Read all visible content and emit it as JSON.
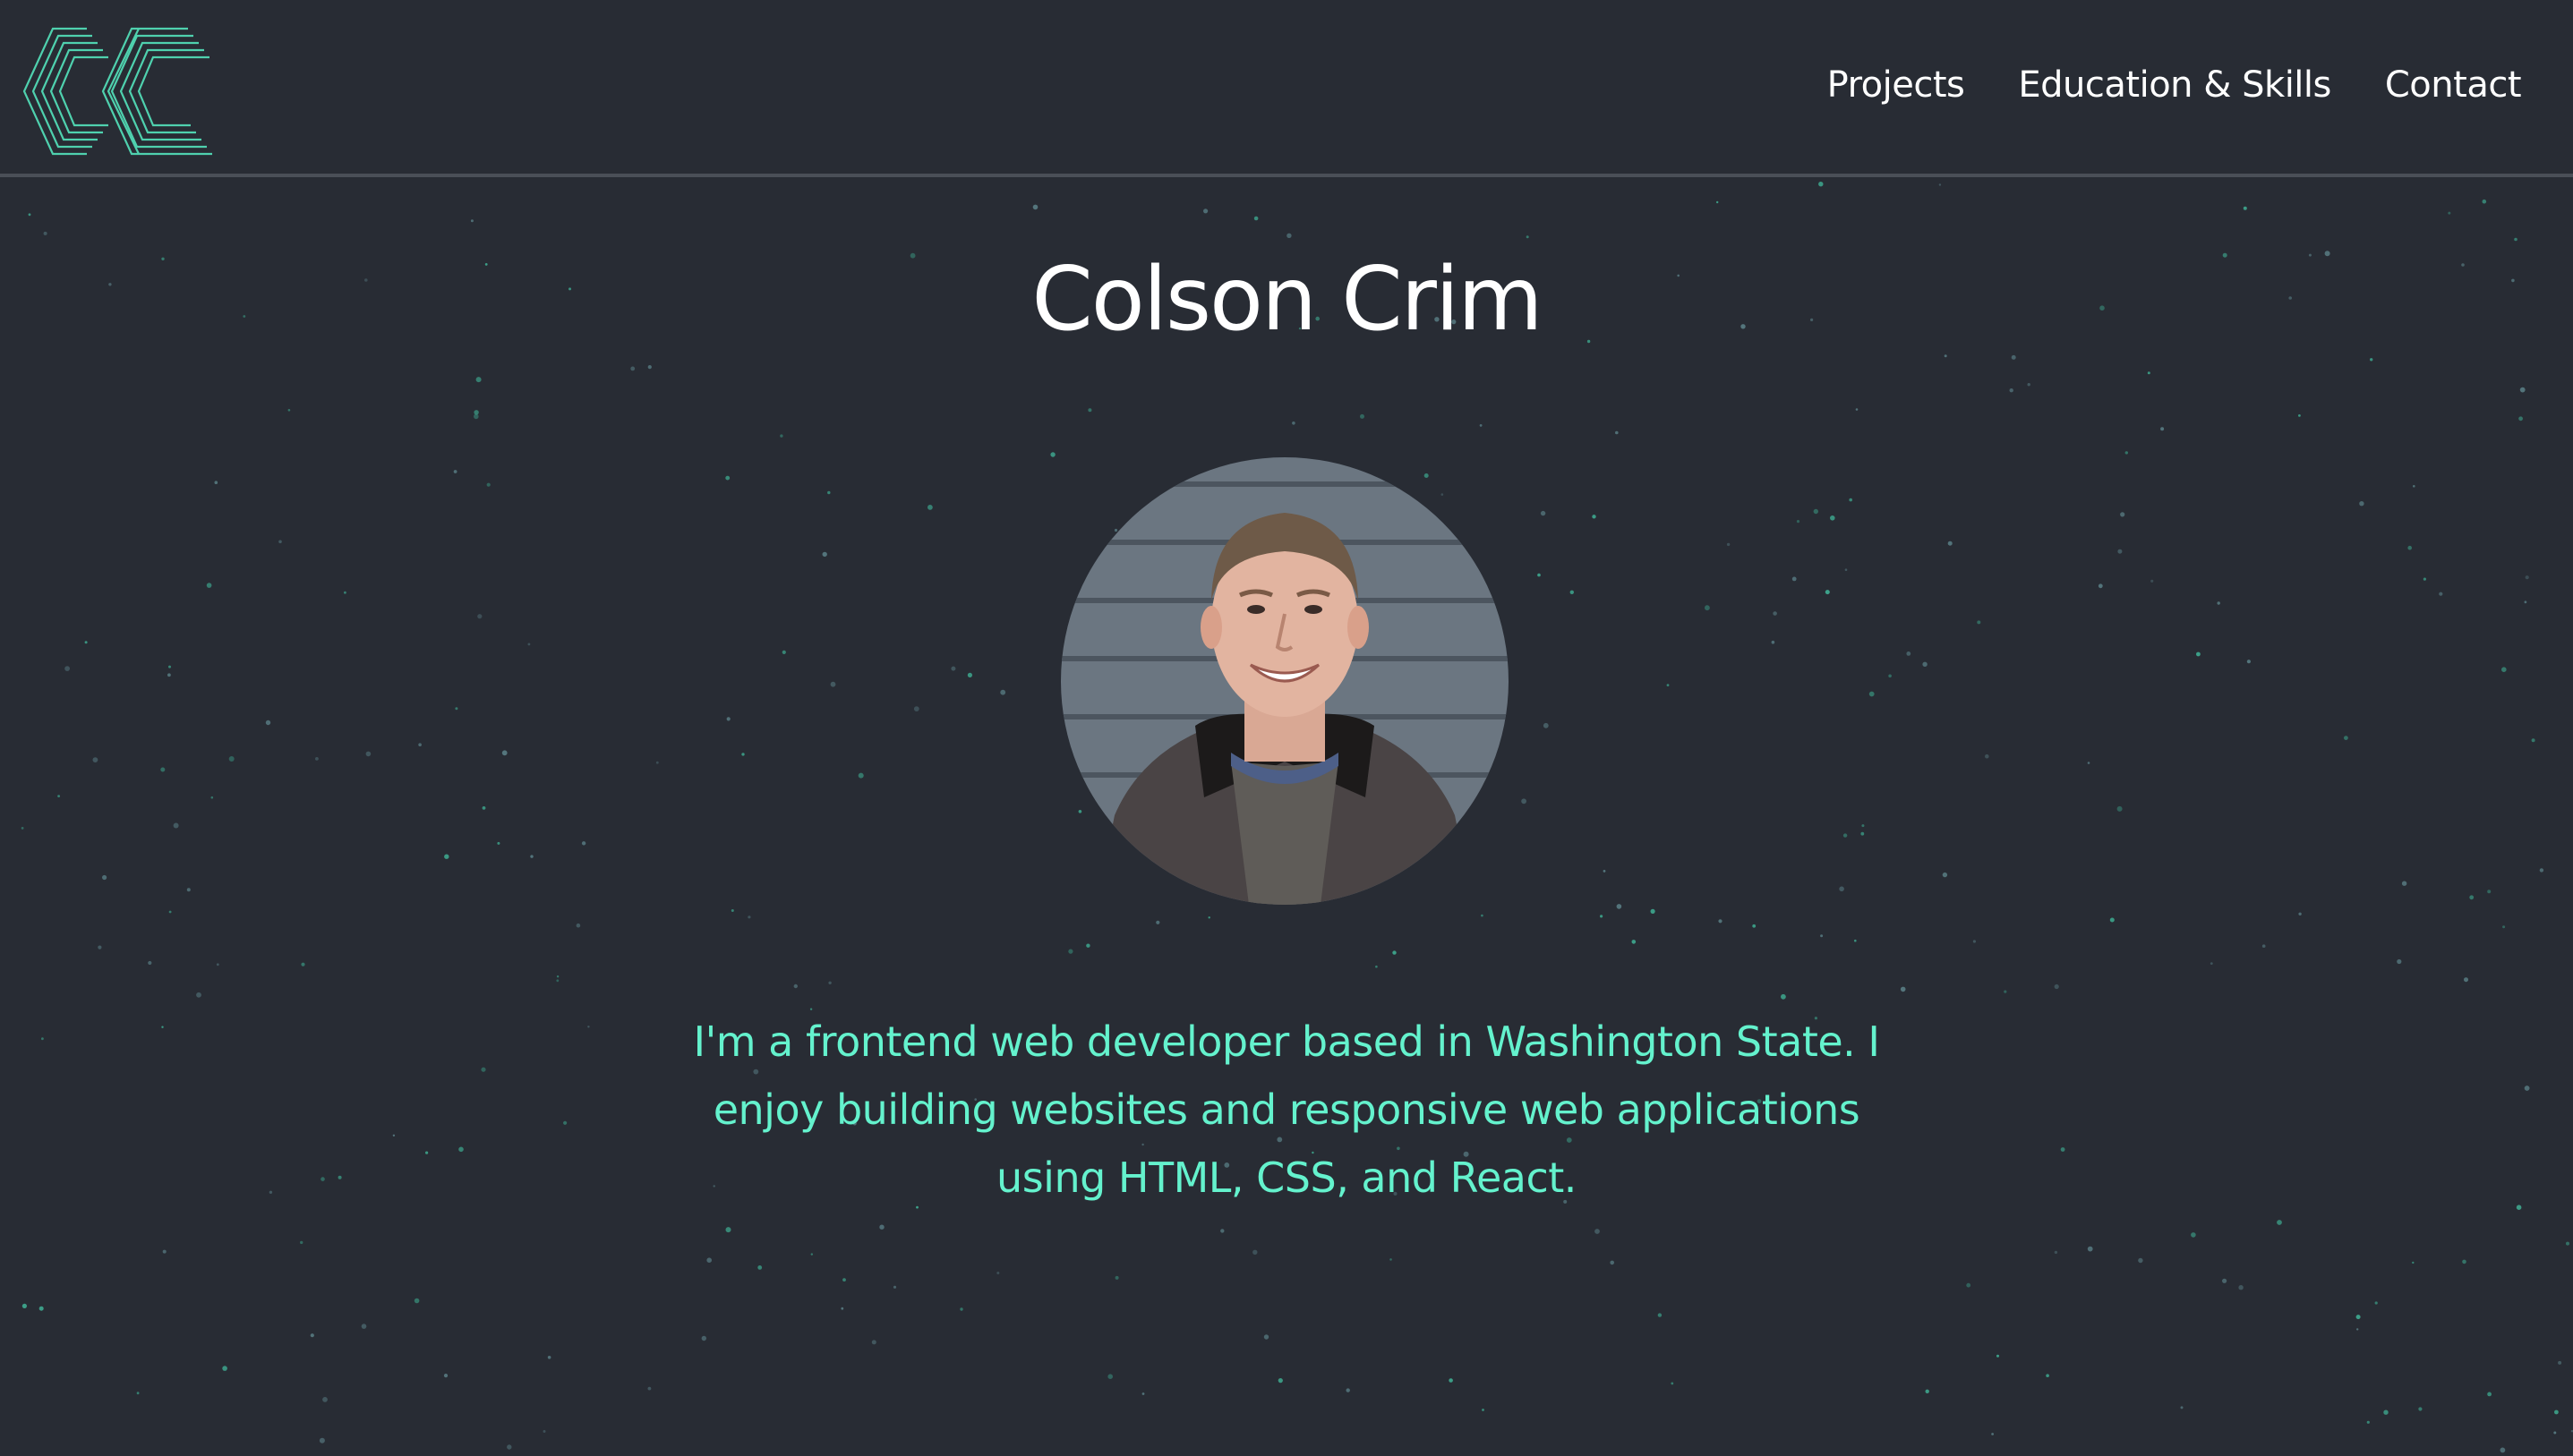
{
  "logo": {
    "label": "CC",
    "icon": "cc-monogram-logo-icon"
  },
  "nav": {
    "items": [
      {
        "label": "Projects"
      },
      {
        "label": "Education & Skills"
      },
      {
        "label": "Contact"
      }
    ]
  },
  "hero": {
    "title": "Colson Crim",
    "bio": "I'm a frontend web developer based in Washington State. I enjoy building websites and responsive web applications using HTML, CSS, and React."
  },
  "colors": {
    "background": "#282c34",
    "accent": "#64f2cd",
    "text": "#ffffff"
  }
}
